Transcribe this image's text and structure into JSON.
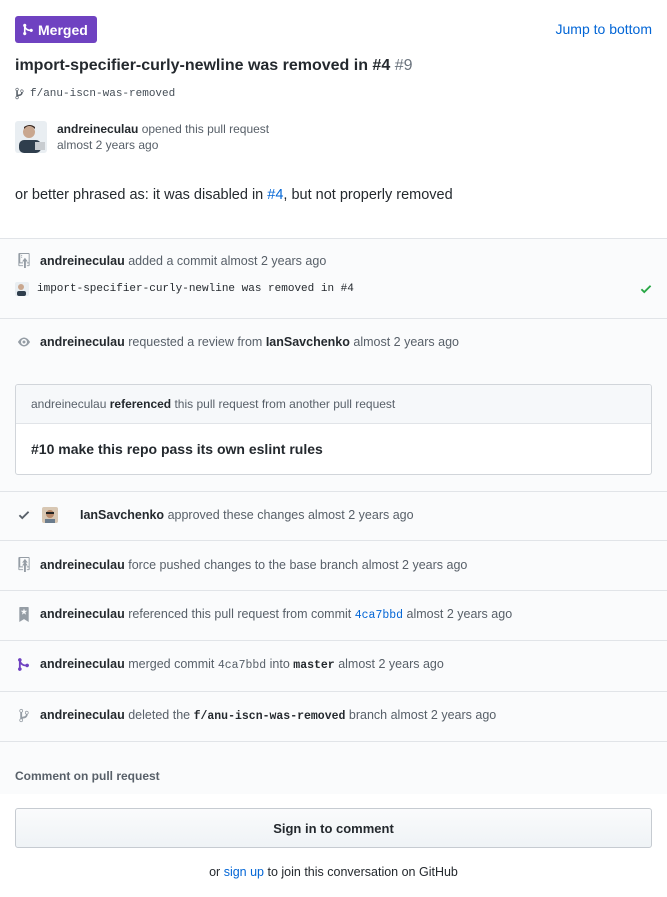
{
  "header": {
    "badge_label": "Merged",
    "jump_label": "Jump to bottom",
    "title_text": "import-specifier-curly-newline was removed in #4",
    "pr_number": "#9",
    "branch_name": "f/anu-iscn-was-removed"
  },
  "opener": {
    "user": "andreineculau",
    "action": "opened this pull request",
    "time": "almost 2 years ago"
  },
  "description": {
    "prefix": "or better phrased as: it was disabled in ",
    "link": "#4",
    "suffix": ", but not properly removed"
  },
  "timeline": {
    "commit_event": {
      "user": "andreineculau",
      "text": "added a commit",
      "time": "almost 2 years ago",
      "commit_message": "import-specifier-curly-newline was removed in #4"
    },
    "review_request": {
      "user": "andreineculau",
      "text": "requested a review from",
      "reviewer": "IanSavchenko",
      "time": "almost 2 years ago"
    },
    "cross_ref": {
      "user": "andreineculau",
      "referenced": "referenced",
      "text": "this pull request from another pull request",
      "pr_title": "#10 make this repo pass its own eslint rules"
    },
    "approval": {
      "user": "IanSavchenko",
      "text": "approved these changes",
      "time": "almost 2 years ago"
    },
    "force_push": {
      "user": "andreineculau",
      "text": "force pushed changes to the base branch",
      "time": "almost 2 years ago"
    },
    "commit_ref": {
      "user": "andreineculau",
      "text": "referenced this pull request from commit",
      "sha": "4ca7bbd",
      "time": "almost 2 years ago"
    },
    "merge": {
      "user": "andreineculau",
      "text": "merged commit",
      "sha": "4ca7bbd",
      "into": "into",
      "base": "master",
      "time": "almost 2 years ago"
    },
    "branch_delete": {
      "user": "andreineculau",
      "text": "deleted the",
      "branch": "f/anu-iscn-was-removed",
      "branch_word": "branch",
      "time": "almost 2 years ago"
    }
  },
  "comment": {
    "label": "Comment on pull request",
    "sign_in_button": "Sign in to comment",
    "footer_prefix": "or",
    "footer_link": "sign up",
    "footer_suffix": "to join this conversation on GitHub"
  },
  "colors": {
    "merged_purple": "#6f42c1",
    "link_blue": "#0366d6",
    "success_green": "#28a745",
    "text_dark": "#24292e",
    "text_muted": "#586069"
  }
}
